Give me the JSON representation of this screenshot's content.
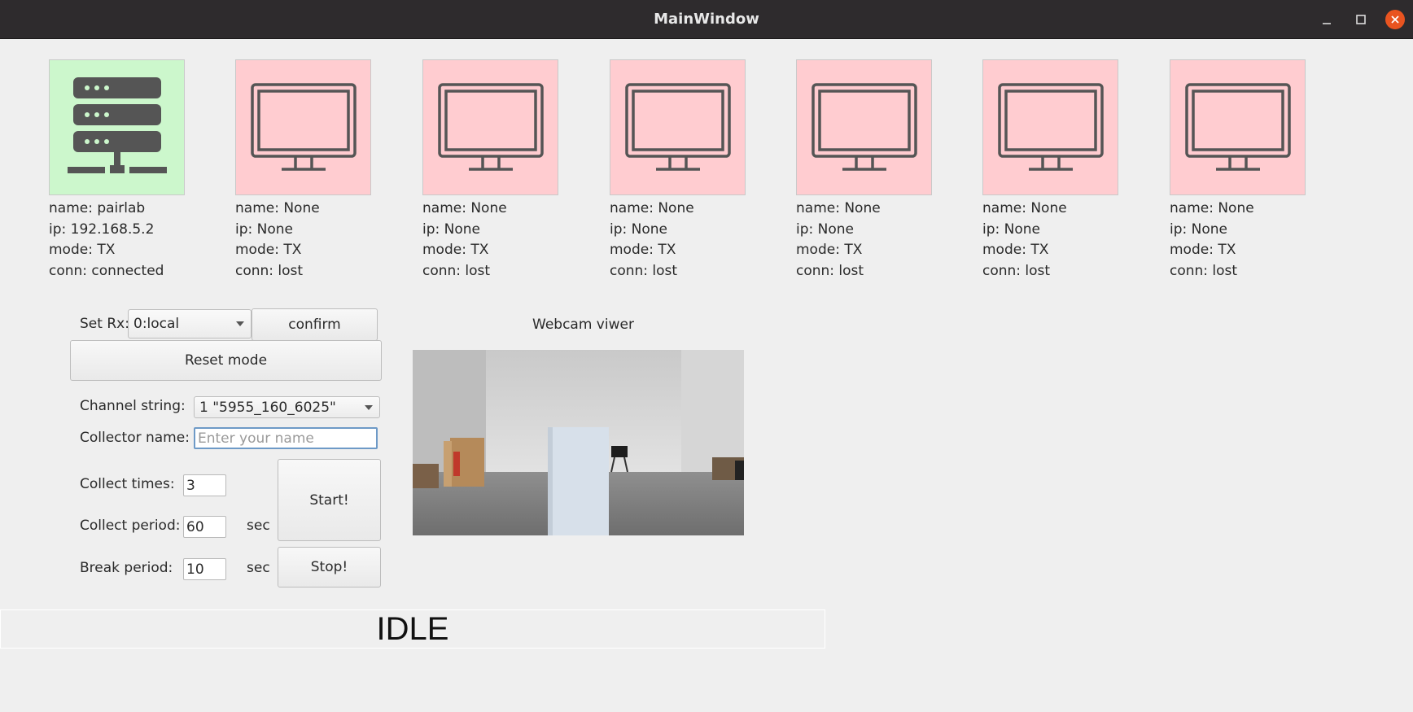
{
  "window": {
    "title": "MainWindow"
  },
  "devices": [
    {
      "type": "server",
      "bg": "#ccf7cc",
      "name": "name: pairlab",
      "ip": "ip: 192.168.5.2",
      "mode": "mode: TX",
      "conn": "conn: connected"
    },
    {
      "type": "monitor",
      "bg": "#ffccd0",
      "name": "name: None",
      "ip": "ip: None",
      "mode": "mode: TX",
      "conn": "conn: lost"
    },
    {
      "type": "monitor",
      "bg": "#ffccd0",
      "name": "name: None",
      "ip": "ip: None",
      "mode": "mode: TX",
      "conn": "conn: lost"
    },
    {
      "type": "monitor",
      "bg": "#ffccd0",
      "name": "name: None",
      "ip": "ip: None",
      "mode": "mode: TX",
      "conn": "conn: lost"
    },
    {
      "type": "monitor",
      "bg": "#ffccd0",
      "name": "name: None",
      "ip": "ip: None",
      "mode": "mode: TX",
      "conn": "conn: lost"
    },
    {
      "type": "monitor",
      "bg": "#ffccd0",
      "name": "name: None",
      "ip": "ip: None",
      "mode": "mode: TX",
      "conn": "conn: lost"
    },
    {
      "type": "monitor",
      "bg": "#ffccd0",
      "name": "name: None",
      "ip": "ip: None",
      "mode": "mode: TX",
      "conn": "conn: lost"
    }
  ],
  "controls": {
    "set_rx_label": "Set Rx:",
    "set_rx_value": "0:local",
    "confirm_label": "confirm",
    "reset_mode_label": "Reset mode",
    "channel_label": "Channel string:",
    "channel_value": "1 \"5955_160_6025\"",
    "collector_label": "Collector name:",
    "collector_value": "",
    "collector_placeholder": "Enter your name",
    "collect_times_label": "Collect times:",
    "collect_times_value": "3",
    "collect_period_label": "Collect period:",
    "collect_period_value": "60",
    "collect_period_unit": "sec",
    "break_period_label": "Break period:",
    "break_period_value": "10",
    "break_period_unit": "sec",
    "start_label": "Start!",
    "stop_label": "Stop!"
  },
  "webcam": {
    "title": "Webcam viwer"
  },
  "status": {
    "text": "IDLE"
  },
  "colors": {
    "titlebar": "#2e2b2d",
    "close_button": "#e95420",
    "connected": "#ccf7cc",
    "lost": "#ffccd0"
  }
}
